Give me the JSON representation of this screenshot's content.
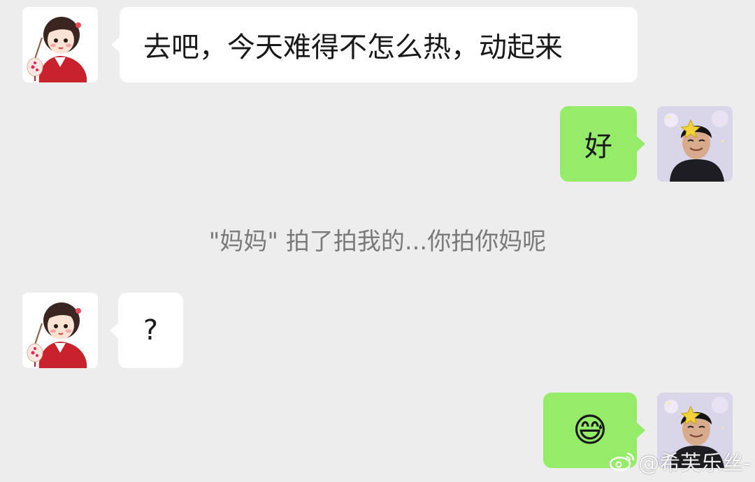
{
  "messages": [
    {
      "id": "m1",
      "side": "left",
      "text": "去吧，今天难得不怎么热，动起来",
      "avatar": "girl-avatar"
    },
    {
      "id": "m2",
      "side": "right",
      "text": "好",
      "avatar": "boy-avatar"
    },
    {
      "id": "m3",
      "side": "left",
      "text": "?",
      "avatar": "girl-avatar"
    },
    {
      "id": "m4",
      "side": "right",
      "text": "😅",
      "avatar": "boy-avatar"
    }
  ],
  "system_message": "\"妈妈\" 拍了拍我的...你拍你妈呢",
  "watermark": "@希芙乐丝-",
  "colors": {
    "background": "#ededed",
    "incoming_bubble": "#ffffff",
    "outgoing_bubble": "#95ec69",
    "system_text": "#7a7a7a"
  }
}
